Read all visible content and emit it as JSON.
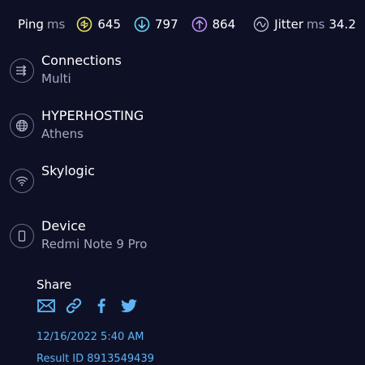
{
  "metrics": {
    "ping_label": "Ping",
    "ping_unit": "ms",
    "ping_value": "645",
    "download_value": "797",
    "upload_value": "864",
    "jitter_label": "Jitter",
    "jitter_unit": "ms",
    "jitter_value": "34.2",
    "icons": {
      "ping": "ping-bolt-icon",
      "download": "download-arrow-icon",
      "upload": "upload-arrow-icon",
      "jitter": "jitter-wave-icon"
    },
    "colors": {
      "ping": "#e8e25a",
      "download": "#6fd3f0",
      "upload": "#c08ff2",
      "jitter": "#b9bdd0"
    }
  },
  "rows": {
    "connections": {
      "title": "Connections",
      "subtitle": "Multi",
      "icon": "connections-arrows-icon"
    },
    "server": {
      "title": "HYPERHOSTING",
      "subtitle": "Athens",
      "icon": "globe-icon"
    },
    "provider": {
      "title": "Skylogic",
      "icon": "wifi-icon"
    },
    "device": {
      "title": "Device",
      "subtitle": "Redmi Note 9 Pro",
      "icon": "phone-icon"
    }
  },
  "share": {
    "label": "Share",
    "icons": [
      "email-icon",
      "link-icon",
      "facebook-icon",
      "twitter-icon"
    ],
    "color": "#5fb4f5"
  },
  "result": {
    "date": "12/16/2022 5:40 AM",
    "id_text": "Result ID 8913549439"
  }
}
